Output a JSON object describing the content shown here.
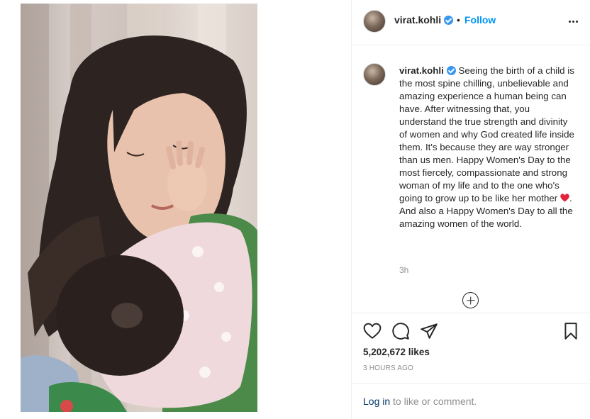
{
  "post": {
    "username": "virat.kohli",
    "follow_label": "Follow",
    "separator": "•",
    "caption": "Seeing the birth of a child is the most spine chilling, unbelievable and amazing experience a human being can have. After witnessing that, you understand the true strength and divinity of women and why God created life inside them. It's because they are way stronger than us men. Happy Women's Day to the most fiercely, compassionate and strong woman of my life and to the one who's going to grow up to be like her mother",
    "caption_tail": ". And also a Happy Women's Day to all the amazing women of the world.",
    "caption_time": "3h",
    "likes": "5,202,672 likes",
    "timestamp": "3 HOURS AGO",
    "login_link": "Log in",
    "login_rest": " to like or comment."
  },
  "icons": {
    "verified": "verified-badge-icon",
    "more": "more-options-icon",
    "heart_emoji": "red-heart-emoji",
    "load_more": "plus-circle-icon",
    "like": "heart-outline-icon",
    "comment": "comment-bubble-icon",
    "share": "paper-plane-icon",
    "save": "bookmark-icon"
  },
  "colors": {
    "accent": "#0095f6",
    "verified": "#3897f0",
    "text": "#262626",
    "muted": "#8e8e8e",
    "link": "#00376b",
    "heart": "#ed4956"
  }
}
